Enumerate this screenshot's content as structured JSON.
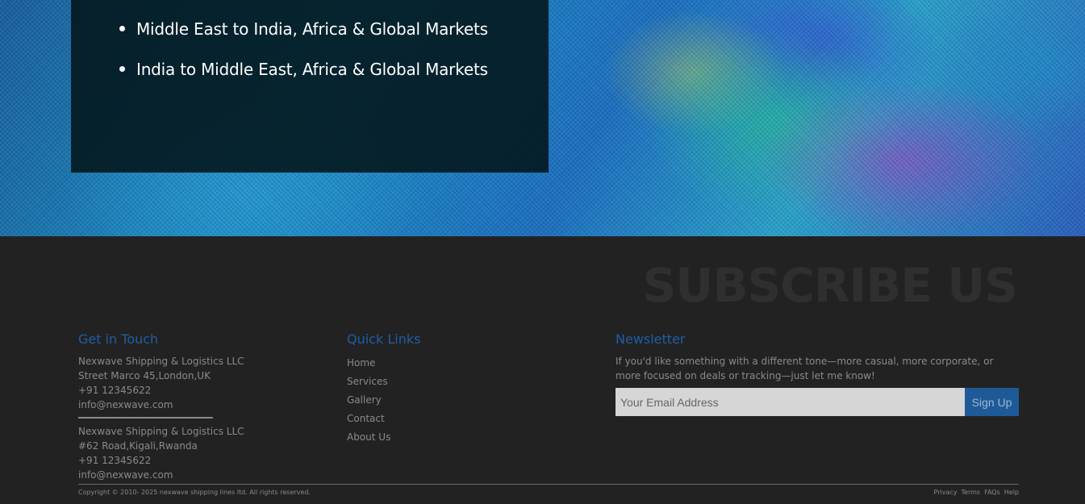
{
  "hero": {
    "markets": [
      "Middle East to India, Africa & Global Markets",
      "India to Middle East, Africa & Global Markets"
    ]
  },
  "footer": {
    "subscribe_heading": "SUBSCRIBE US",
    "get_in_touch": {
      "title": "Get in Touch",
      "offices": [
        {
          "company": "Nexwave Shipping & Logistics LLC",
          "address": "Street Marco 45,London,UK",
          "phone": "+91 12345622",
          "email": "info@nexwave.com"
        },
        {
          "company": "Nexwave Shipping & Logistics LLC",
          "address": "#62 Road,Kigali,Rwanda",
          "phone": "+91 12345622",
          "email": "info@nexwave.com"
        }
      ]
    },
    "quick_links": {
      "title": "Quick Links",
      "items": [
        "Home",
        "Services",
        "Gallery",
        "Contact",
        "About Us"
      ]
    },
    "newsletter": {
      "title": "Newsletter",
      "text": "If you'd like something with a different tone—more casual, more corporate, or more focused on deals or tracking—just let me know!",
      "email_placeholder": "Your Email Address",
      "email_value": "",
      "button_label": "Sign Up"
    },
    "copyright": "Copyright © 2010- 2025 nexwave shipping lines ltd. All rights reserved.",
    "legal_links": [
      "Privacy",
      "Terms",
      "FAQs",
      "Help"
    ]
  },
  "colors": {
    "footer_bg": "#222222",
    "accent_blue": "#1e5fa6",
    "muted_text": "#8a8a8a"
  }
}
